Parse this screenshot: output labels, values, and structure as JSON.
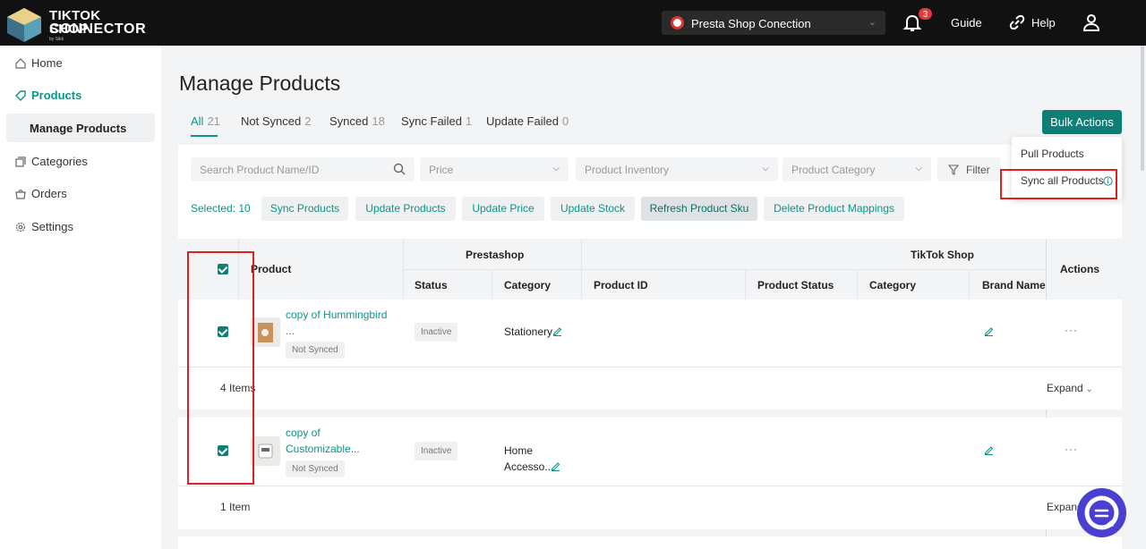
{
  "header": {
    "logo_line1": "TIKTOK SHOP",
    "logo_line2": "CONNECTOR",
    "logo_by": "by Sikk",
    "shop_select": "Presta Shop Conection",
    "notification_count": "3",
    "guide": "Guide",
    "help": "Help"
  },
  "sidebar": {
    "items": [
      {
        "label": "Home",
        "icon": "home-icon"
      },
      {
        "label": "Products",
        "icon": "tag-icon"
      },
      {
        "label": "Manage Products"
      },
      {
        "label": "Categories",
        "icon": "categories-icon"
      },
      {
        "label": "Orders",
        "icon": "orders-icon"
      },
      {
        "label": "Settings",
        "icon": "gear-icon"
      }
    ]
  },
  "main": {
    "title": "Manage Products",
    "tabs": [
      {
        "label": "All",
        "count": "21"
      },
      {
        "label": "Not Synced",
        "count": "2"
      },
      {
        "label": "Synced",
        "count": "18"
      },
      {
        "label": "Sync Failed",
        "count": "1"
      },
      {
        "label": "Update Failed",
        "count": "0"
      }
    ],
    "bulk_actions": "Bulk Actions",
    "bulk_menu": [
      "Pull Products",
      "Sync all Products"
    ],
    "filters": {
      "search_placeholder": "Search Product Name/ID",
      "price": "Price",
      "inventory": "Product Inventory",
      "category": "Product Category",
      "filter": "Filter"
    },
    "selected": "Selected: 10",
    "actions": [
      "Sync Products",
      "Update Products",
      "Update Price",
      "Update Stock",
      "Refresh Product Sku",
      "Delete Product Mappings"
    ]
  },
  "table": {
    "headers": {
      "product": "Product",
      "prestashop": "Prestashop",
      "tiktok": "TikTok Shop",
      "actions": "Actions",
      "ps_status": "Status",
      "ps_category": "Category",
      "tt_product_id": "Product ID",
      "tt_product_status": "Product Status",
      "tt_category": "Category",
      "tt_brand": "Brand Name"
    },
    "rows": [
      {
        "name_line1": "copy of Hummingbird",
        "name_line2": "...",
        "tag": "Not Synced",
        "status": "Inactive",
        "category_line1": "Stationery",
        "category_line2": "",
        "more": "···",
        "items": "4 Items",
        "expand": "Expand"
      },
      {
        "name_line1": "copy of",
        "name_line2": "Customizable...",
        "tag": "Not Synced",
        "status": "Inactive",
        "category_line1": "Home",
        "category_line2": "Accesso...",
        "more": "···",
        "items": "1 Item",
        "expand": "Expand"
      }
    ]
  },
  "colors": {
    "accent": "#0d9488",
    "bulk_button": "#0d7f74",
    "highlight": "#e02020",
    "chat": "#4a3fd1"
  }
}
